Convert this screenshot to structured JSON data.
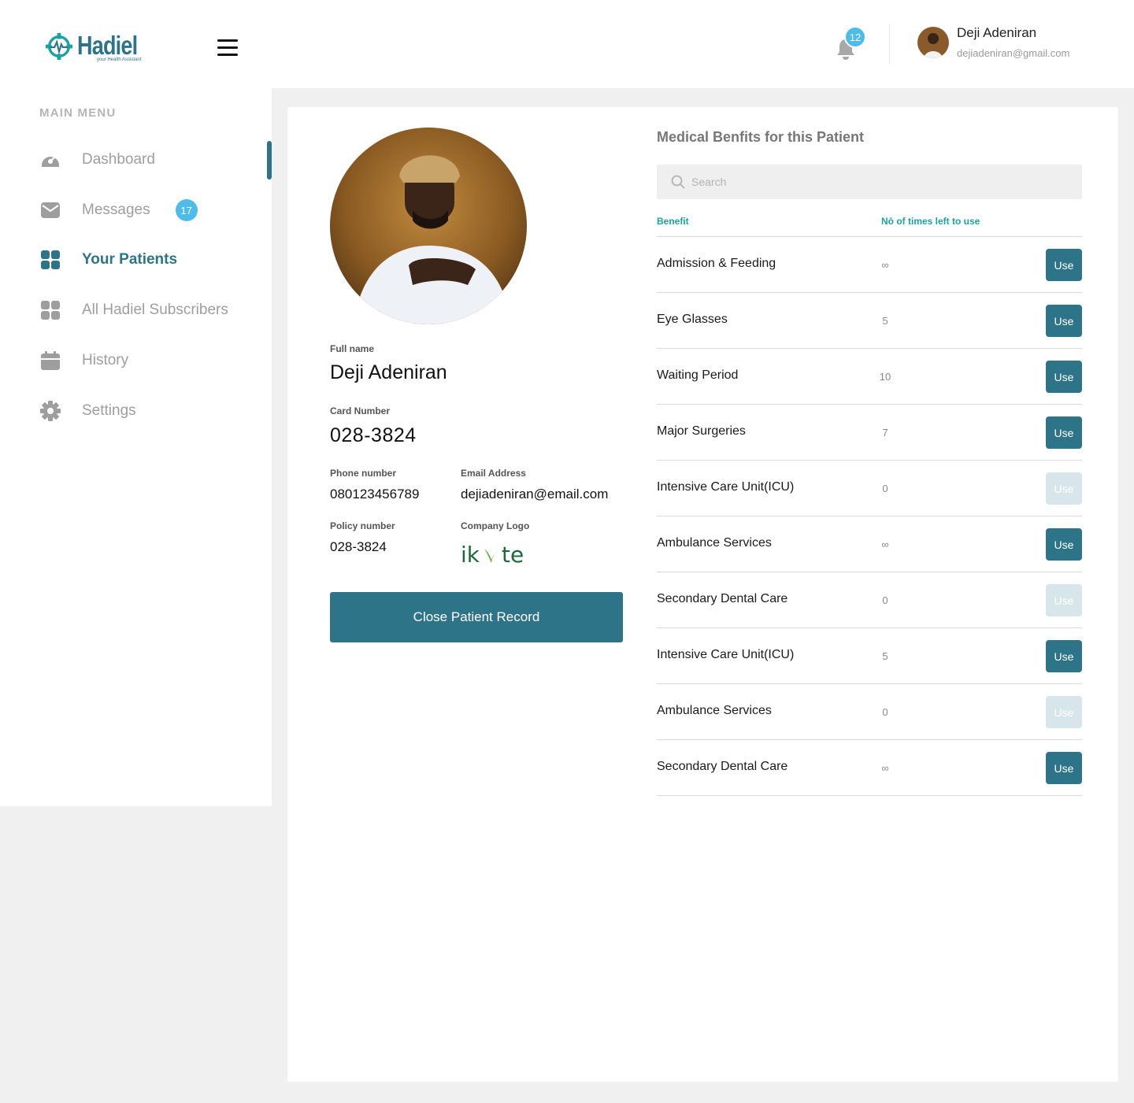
{
  "brand": {
    "name": "Hadiel",
    "tagline": "your Health Assistant"
  },
  "sidebar": {
    "menu_title": "MAIN MENU",
    "items": [
      {
        "label": "Dashboard",
        "icon": "dashboard-icon"
      },
      {
        "label": "Messages",
        "icon": "mail-icon",
        "badge": "17"
      },
      {
        "label": "Your Patients",
        "icon": "grid-icon",
        "active": true
      },
      {
        "label": "All Hadiel Subscribers",
        "icon": "grid-icon"
      },
      {
        "label": "History",
        "icon": "calendar-icon"
      },
      {
        "label": "Settings",
        "icon": "gear-icon"
      }
    ]
  },
  "header": {
    "notifications_count": "12",
    "user": {
      "name": "Deji Adeniran",
      "email": "dejiadeniran@gmail.com"
    }
  },
  "patient": {
    "full_name_label": "Full name",
    "full_name": "Deji Adeniran",
    "card_number_label": "Card Number",
    "card_number": "028-3824",
    "phone_label": "Phone number",
    "phone": "080123456789",
    "email_label": "Email Address",
    "email": "dejiadeniran@email.com",
    "policy_label": "Policy number",
    "policy": "028-3824",
    "company_logo_label": "Company Logo",
    "company_logo_text": "ikvte",
    "close_button": "Close Patient Record"
  },
  "benefits": {
    "title": "Medical Benfits for this Patient",
    "search_placeholder": "Search",
    "col_benefit": "Benefit",
    "col_times": "Nō of times left to use",
    "use_label": "Use",
    "rows": [
      {
        "name": "Admission & Feeding",
        "count": "∞",
        "enabled": true
      },
      {
        "name": "Eye Glasses",
        "count": "5",
        "enabled": true
      },
      {
        "name": "Waiting Period",
        "count": "10",
        "enabled": true
      },
      {
        "name": "Major Surgeries",
        "count": "7",
        "enabled": true
      },
      {
        "name": "Intensive Care Unit(ICU)",
        "count": "0",
        "enabled": false
      },
      {
        "name": "Ambulance Services",
        "count": "∞",
        "enabled": true
      },
      {
        "name": "Secondary Dental Care",
        "count": "0",
        "enabled": false
      },
      {
        "name": "Intensive Care Unit(ICU)",
        "count": "5",
        "enabled": true
      },
      {
        "name": "Ambulance Services",
        "count": "0",
        "enabled": false
      },
      {
        "name": "Secondary Dental Care",
        "count": "∞",
        "enabled": true
      }
    ]
  },
  "colors": {
    "primary": "#2e7489",
    "accent": "#4dbce9",
    "teal_header": "#1aa3a0"
  }
}
